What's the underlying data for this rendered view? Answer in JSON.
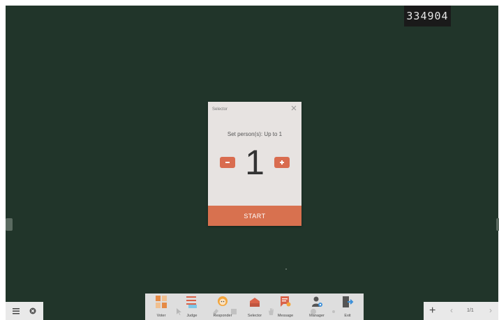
{
  "session": {
    "code": "334904"
  },
  "dialog": {
    "title": "Selector",
    "prompt": "Set person(s): Up to 1",
    "count": "1",
    "start_label": "START"
  },
  "toolbar": {
    "items": [
      {
        "label": "Voter",
        "icon": "voter-icon"
      },
      {
        "label": "Judge",
        "icon": "judge-icon"
      },
      {
        "label": "Responder",
        "icon": "responder-icon"
      },
      {
        "label": "Selector",
        "icon": "selector-icon"
      },
      {
        "label": "Message",
        "icon": "message-icon"
      },
      {
        "label": "Manager",
        "icon": "manager-icon"
      },
      {
        "label": "Exit",
        "icon": "exit-icon"
      }
    ]
  },
  "pager": {
    "page": "1/1"
  },
  "colors": {
    "board": "#21352a",
    "accent": "#d8714f",
    "dialog_bg": "#e7e3e1"
  }
}
